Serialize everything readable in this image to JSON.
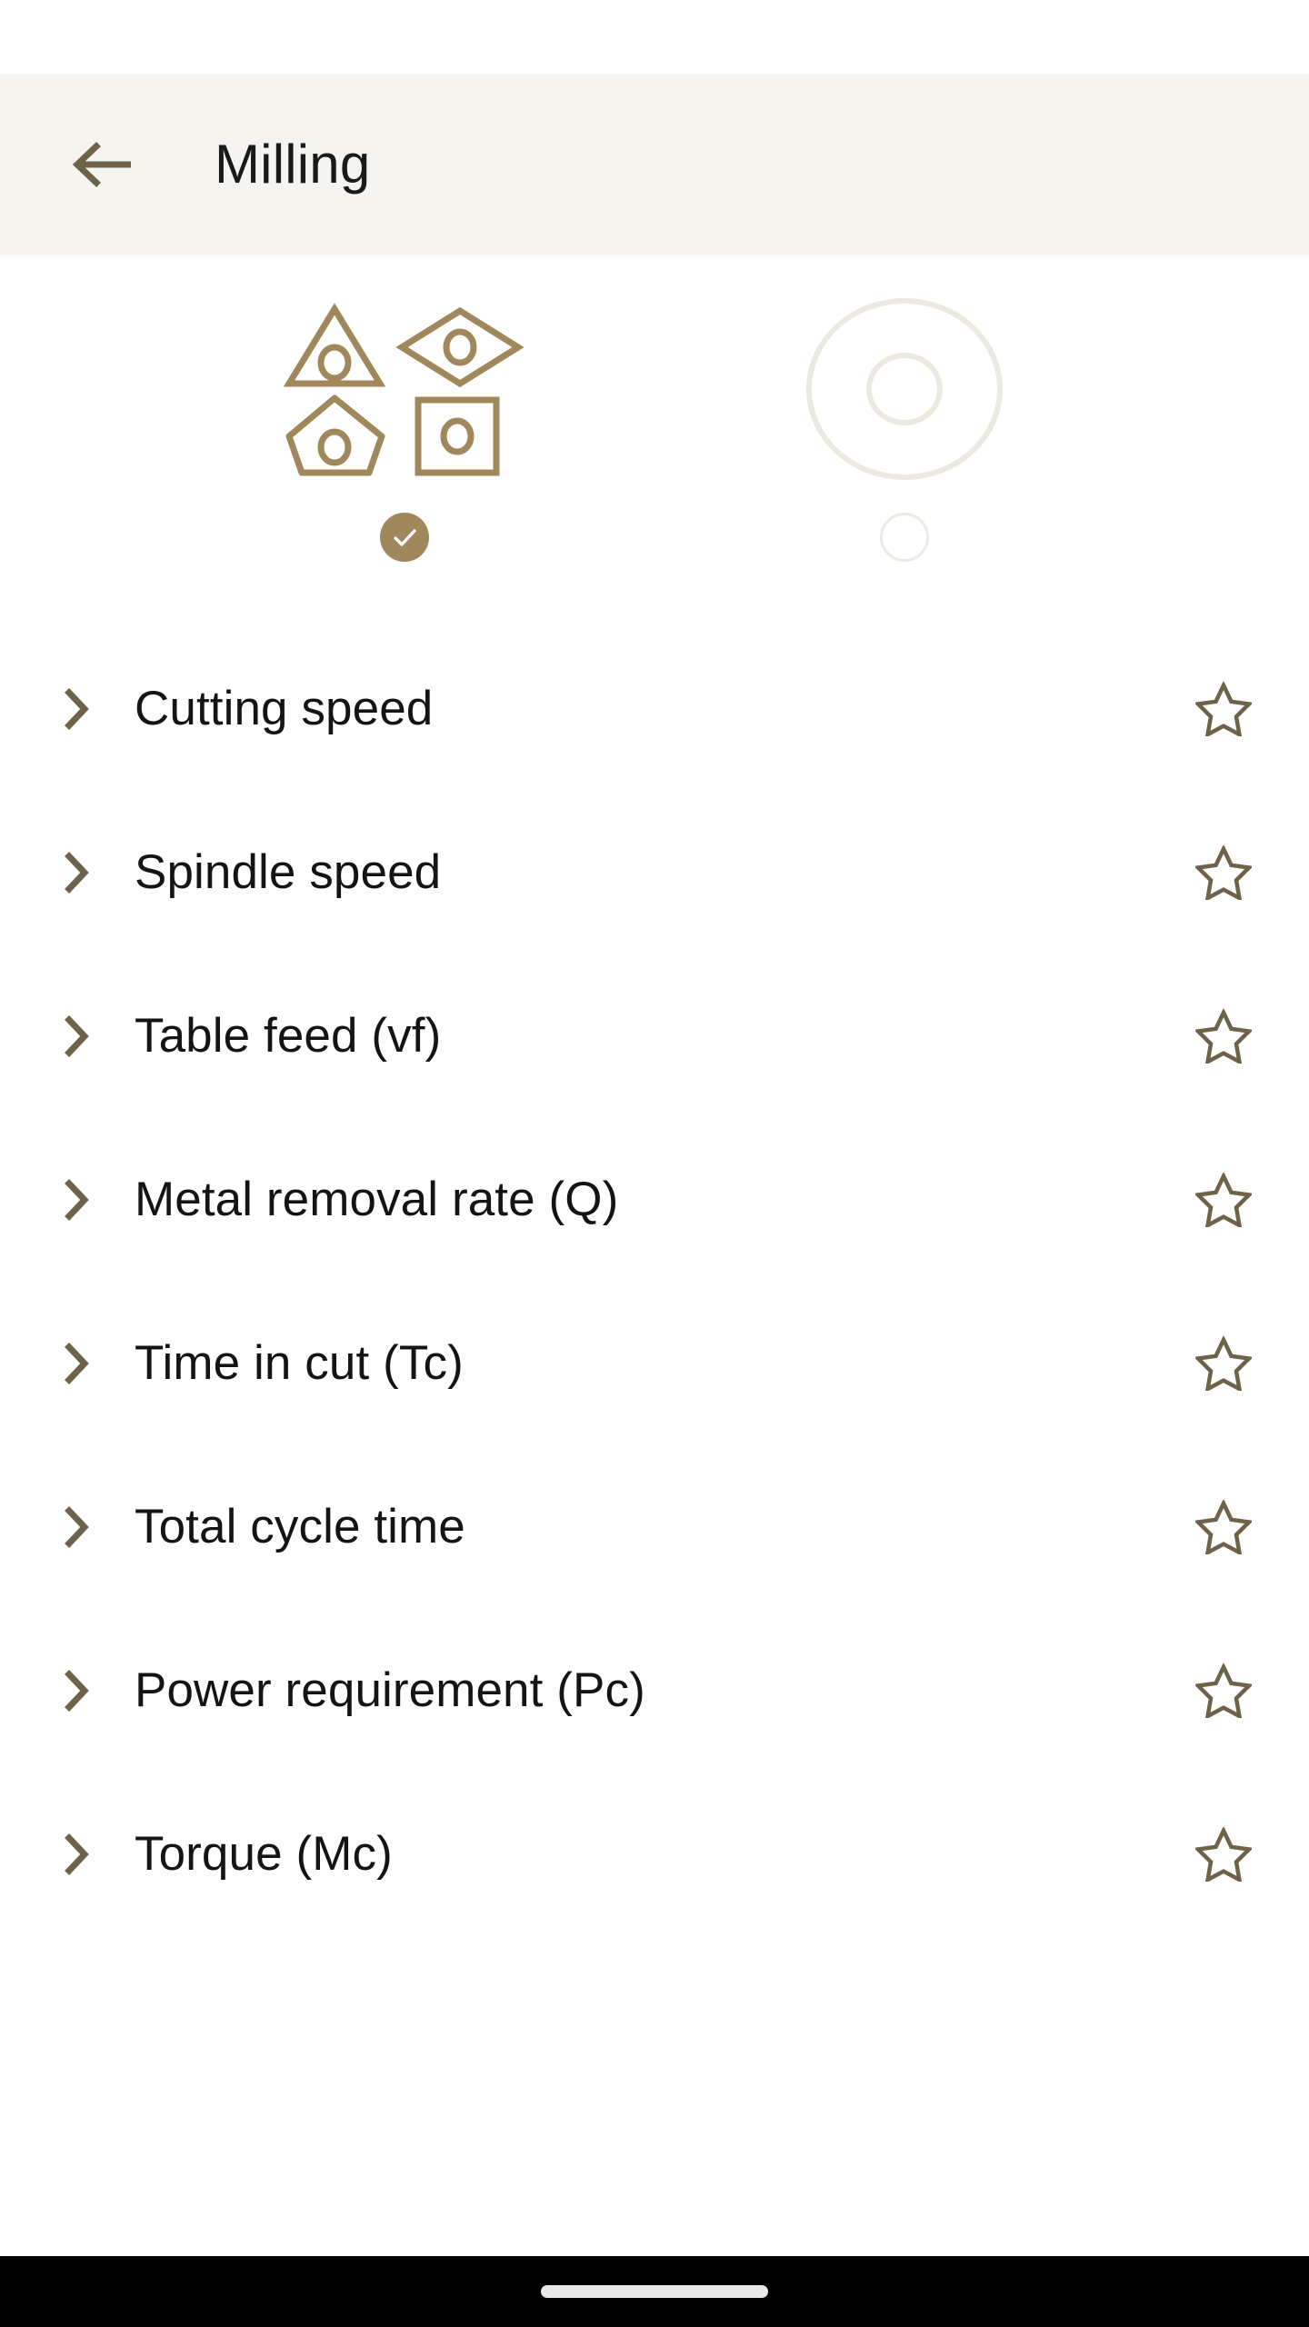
{
  "theme": {
    "gold": "#a0885c",
    "gold_light": "#ece9e0",
    "olive": "#6e6349",
    "header_bg": "#f5f4ef",
    "page_bg": "#ffffff",
    "text": "#141414",
    "nav_bg": "#000000"
  },
  "header": {
    "back_icon": "arrow-left-icon",
    "title": "Milling"
  },
  "tool_selector": {
    "options": [
      {
        "id": "indexable-inserts",
        "icon": "insert-shapes-icon",
        "shapes": [
          "triangle",
          "rhombus",
          "trigon",
          "square"
        ],
        "selected": true,
        "radio_icon": "check-icon"
      },
      {
        "id": "round-insert",
        "icon": "round-insert-icon",
        "shapes": [
          "circle-outer",
          "circle-inner"
        ],
        "selected": false,
        "radio_icon": "circle-outline-icon"
      }
    ]
  },
  "parameters": {
    "chevron_icon": "chevron-right-icon",
    "star_icon": "star-outline-icon",
    "items": [
      {
        "label": "Cutting speed",
        "favorite": false
      },
      {
        "label": "Spindle speed",
        "favorite": false
      },
      {
        "label": "Table feed (vf)",
        "favorite": false
      },
      {
        "label": "Metal removal rate (Q)",
        "favorite": false
      },
      {
        "label": "Time in cut (Tc)",
        "favorite": false
      },
      {
        "label": "Total cycle time",
        "favorite": false
      },
      {
        "label": "Power requirement (Pc)",
        "favorite": false
      },
      {
        "label": "Torque (Mc)",
        "favorite": false
      }
    ]
  },
  "system_nav": {
    "gesture_pill": "home-gesture-pill"
  }
}
